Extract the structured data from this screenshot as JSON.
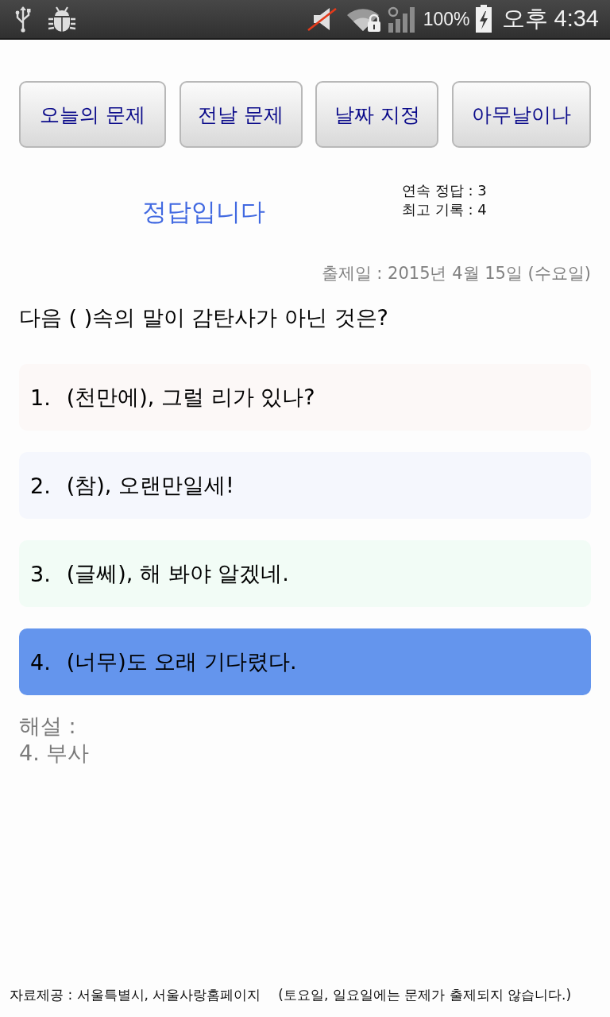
{
  "status_bar": {
    "battery": "100%",
    "time": "오후 4:34"
  },
  "nav_buttons": [
    {
      "label": "오늘의 문제"
    },
    {
      "label": "전날 문제"
    },
    {
      "label": "날짜 지정"
    },
    {
      "label": "아무날이나"
    }
  ],
  "result": {
    "message": "정답입니다",
    "streak": "연속 정답 : 3",
    "best": "최고 기록 : 4"
  },
  "quiz": {
    "date": "출제일 : 2015년 4월 15일 (수요일)",
    "question": "다음 ( )속의 말이 감탄사가 아닌 것은?",
    "options": [
      {
        "number": "1.",
        "text": "(천만에), 그럴 리가 있나?",
        "color": "#fcf8f7",
        "selected": false
      },
      {
        "number": "2.",
        "text": "(참), 오랜만일세!",
        "color": "#f5f7fd",
        "selected": false
      },
      {
        "number": "3.",
        "text": "(글쎄), 해 봐야 알겠네.",
        "color": "#f2fcf6",
        "selected": false
      },
      {
        "number": "4.",
        "text": "(너무)도 오래 기다렸다.",
        "selected": true
      }
    ]
  },
  "explanation": {
    "title": "해설 :",
    "answer": "4. 부사"
  },
  "footer": {
    "source": "자료제공 : 서울특별시, 서울사랑홈페이지",
    "note": "(토요일, 일요일에는 문제가 출제되지 않습니다.)"
  }
}
